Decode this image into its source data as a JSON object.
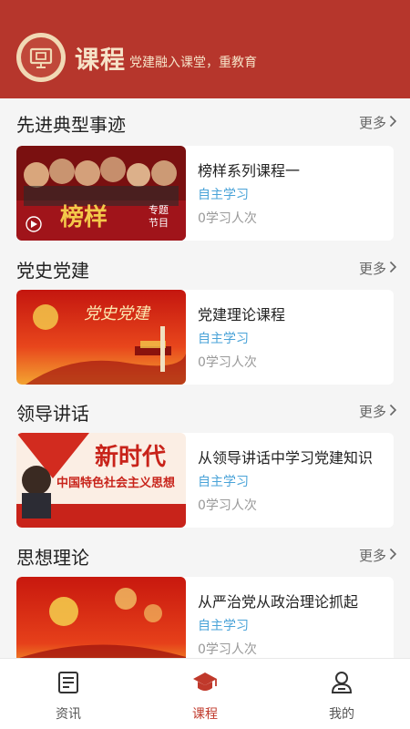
{
  "header": {
    "title": "课程",
    "subtitle": "党建融入课堂，重教育",
    "logo_icon": "presentation-board-icon"
  },
  "sections": [
    {
      "title": "先进典型事迹",
      "more": "更多",
      "course": {
        "title": "榜样系列课程一",
        "tag": "自主学习",
        "count": "0学习人次",
        "thumb_text": "榜样",
        "thumb_badge": "专题节目"
      }
    },
    {
      "title": "党史党建",
      "more": "更多",
      "course": {
        "title": "党建理论课程",
        "tag": "自主学习",
        "count": "0学习人次",
        "thumb_text": "党史党建"
      }
    },
    {
      "title": "领导讲话",
      "more": "更多",
      "course": {
        "title": "从领导讲话中学习党建知识",
        "tag": "自主学习",
        "count": "0学习人次",
        "thumb_text": "新时代",
        "thumb_sub": "中国特色社会主义思想"
      }
    },
    {
      "title": "思想理论",
      "more": "更多",
      "course": {
        "title": "从严治党从政治理论抓起",
        "tag": "自主学习",
        "count": "0学习人次"
      }
    }
  ],
  "tabbar": {
    "tabs": [
      {
        "label": "资讯",
        "icon": "news-icon"
      },
      {
        "label": "课程",
        "icon": "graduation-cap-icon",
        "active": true
      },
      {
        "label": "我的",
        "icon": "user-icon"
      }
    ]
  },
  "colors": {
    "header_bg": "#b6362c",
    "header_text": "#f6e3c8",
    "tag_blue": "#4aa3d8",
    "active_tab": "#c0392b"
  }
}
